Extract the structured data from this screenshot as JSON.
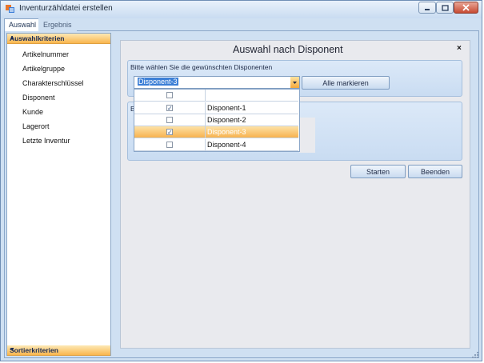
{
  "window": {
    "title": "Inventurzähldatei erstellen"
  },
  "tabs": [
    {
      "label": "Auswahl"
    },
    {
      "label": "Ergebnis"
    }
  ],
  "sidebar": {
    "header": "Auswahlkriterien",
    "items": [
      {
        "label": "Artikelnummer"
      },
      {
        "label": "Artikelgruppe"
      },
      {
        "label": "Charakterschlüssel"
      },
      {
        "label": "Disponent"
      },
      {
        "label": "Kunde"
      },
      {
        "label": "Lagerort"
      },
      {
        "label": "Letzte Inventur"
      }
    ],
    "footer": "Sortierkriterien"
  },
  "panel": {
    "title": "Auswahl nach Disponent",
    "close_glyph": "×",
    "group1_label": "Bitte wählen Sie die gewünschten Disponenten",
    "group2_label": "B",
    "combo_value": "Disponent-3",
    "select_all_label": "Alle markieren"
  },
  "dropdown": {
    "rows": [
      {
        "label": "",
        "checked": false,
        "selected": false
      },
      {
        "label": "Disponent-1",
        "checked": true,
        "selected": false
      },
      {
        "label": "Disponent-2",
        "checked": false,
        "selected": false
      },
      {
        "label": "Disponent-3",
        "checked": true,
        "selected": true
      },
      {
        "label": "Disponent-4",
        "checked": false,
        "selected": false
      }
    ]
  },
  "actions": {
    "start_label": "Starten",
    "end_label": "Beenden"
  },
  "colors": {
    "accent": "#f7b24f",
    "frame": "#cfe0f2",
    "selection": "#3c7fd6"
  }
}
